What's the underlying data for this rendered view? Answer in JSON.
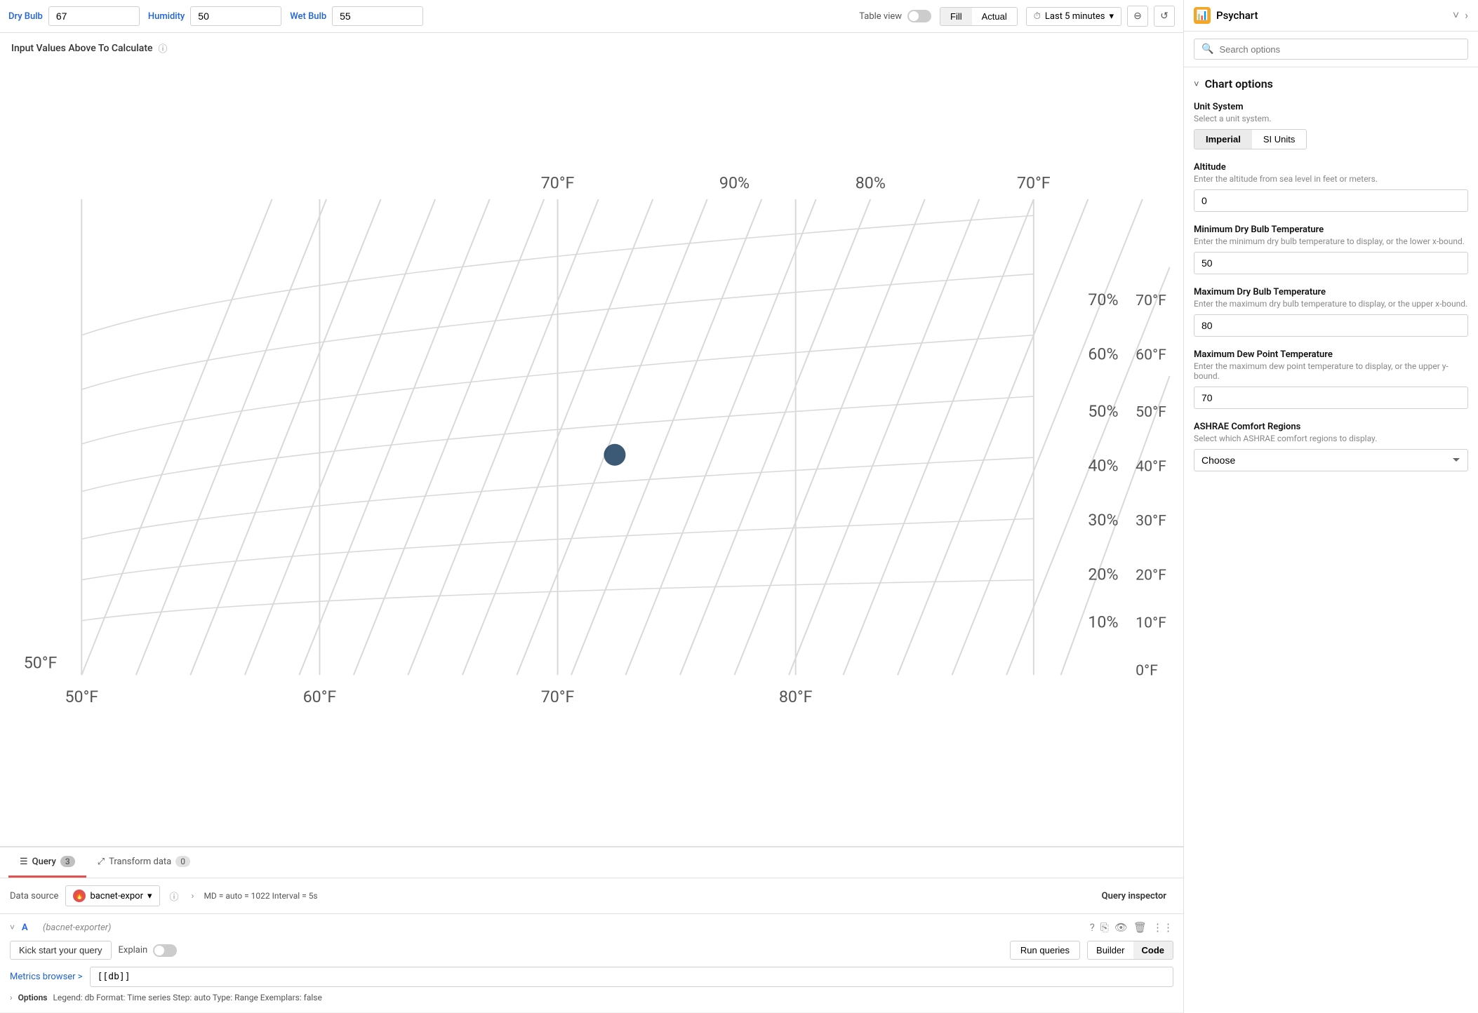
{
  "top": {
    "inputs": [
      {
        "label": "Dry Bulb",
        "value": "67"
      },
      {
        "label": "Humidity",
        "value": "50"
      },
      {
        "label": "Wet Bulb",
        "value": "55"
      }
    ],
    "tableViewLabel": "Table view",
    "fillLabel": "Fill",
    "actualLabel": "Actual",
    "timeLabel": "Last 5 minutes"
  },
  "chart": {
    "title": "Input Values Above To Calculate",
    "xLabels": [
      "50°F",
      "60°F",
      "70°F",
      "80°F"
    ],
    "xGridLines": [
      "50°F",
      "60°F",
      "70°F"
    ],
    "yRightLabels": [
      "10%",
      "20%",
      "30%",
      "40%",
      "50%",
      "60%",
      "70%"
    ],
    "yFarRightLabels": [
      "0°F",
      "10°F",
      "20°F",
      "30°F",
      "40°F",
      "50°F",
      "60°F",
      "70°F"
    ],
    "topLabels": [
      "70°F",
      "90%",
      "80%",
      "70°F"
    ]
  },
  "query": {
    "tabLabel": "Query",
    "tabBadge": "3",
    "transformTabLabel": "Transform data",
    "transformBadge": "0",
    "datasourceLabel": "Data source",
    "datasourceName": "bacnet-expor",
    "mdInfo": "MD = auto = 1022  Interval = 5s",
    "queryInspectorLabel": "Query inspector",
    "queryLetter": "A",
    "querySource": "(bacnet-exporter)",
    "kickStartLabel": "Kick start your query",
    "explainLabel": "Explain",
    "runQueriesLabel": "Run queries",
    "builderLabel": "Builder",
    "codeLabel": "Code",
    "metricsBrowserLabel": "Metrics browser >",
    "metricsInput": "[[db]]",
    "optionsLabel": "Options",
    "optionsDetails": "Legend: db   Format: Time series   Step: auto   Type: Range   Exemplars: false"
  },
  "rightPanel": {
    "title": "Psychart",
    "searchPlaceholder": "Search options",
    "sectionTitle": "Chart options",
    "unitSystem": {
      "label": "Unit System",
      "desc": "Select a unit system.",
      "imperial": "Imperial",
      "siUnits": "SI Units"
    },
    "altitude": {
      "label": "Altitude",
      "desc": "Enter the altitude from sea level in feet or meters.",
      "value": "0"
    },
    "minDryBulb": {
      "label": "Minimum Dry Bulb Temperature",
      "desc": "Enter the minimum dry bulb temperature to display, or the lower x-bound.",
      "value": "50"
    },
    "maxDryBulb": {
      "label": "Maximum Dry Bulb Temperature",
      "desc": "Enter the maximum dry bulb temperature to display, or the upper x-bound.",
      "value": "80"
    },
    "maxDewPoint": {
      "label": "Maximum Dew Point Temperature",
      "desc": "Enter the maximum dew point temperature to display, or the upper y-bound.",
      "value": "70"
    },
    "ashraeComfort": {
      "label": "ASHRAE Comfort Regions",
      "desc": "Select which ASHRAE comfort regions to display.",
      "chooseLabel": "Choose"
    }
  }
}
